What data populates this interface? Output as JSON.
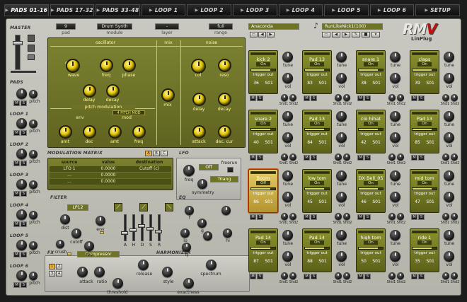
{
  "tabs": [
    {
      "label": "PADS 01-16",
      "active": true
    },
    {
      "label": "PADS 17-32"
    },
    {
      "label": "PADS 33-48"
    },
    {
      "label": "LOOP 1"
    },
    {
      "label": "LOOP 2"
    },
    {
      "label": "LOOP 3"
    },
    {
      "label": "LOOP 4"
    },
    {
      "label": "LOOP 5"
    },
    {
      "label": "LOOP 6"
    },
    {
      "label": "SETUP"
    }
  ],
  "left": {
    "master": "MASTER",
    "pads": "PADS",
    "loops": [
      "LOOP 1",
      "LOOP 2",
      "LOOP 3",
      "LOOP 4",
      "LOOP 5",
      "LOOP 6"
    ],
    "pitch": "pitch",
    "m": "M",
    "s": "S"
  },
  "top": {
    "pad_num": "9",
    "pad_num_lbl": "pad",
    "module": "Drum Synth",
    "module_lbl": "module",
    "layer": "-",
    "layer_lbl": "layer",
    "range": "full",
    "range_lbl": "range"
  },
  "oscillator": {
    "title": "oscillator",
    "knobs": [
      "wave",
      "freq",
      "phase",
      "delay",
      "decay"
    ],
    "pitch_title": "pitch modulation",
    "env": "env",
    "mod": "mod",
    "pm_knobs": [
      "amt",
      "dec",
      "amt",
      "freq"
    ],
    "pm_tag": "4 PITCH MOD"
  },
  "mix": {
    "title": "mix",
    "knob": "mix"
  },
  "noise": {
    "title": "noise",
    "knobs": [
      "col",
      "reso",
      "delay",
      "decay",
      "attack",
      "dec. cur"
    ]
  },
  "modmatrix": {
    "title": "MODULATION MATRIX",
    "tabs": [
      "A",
      "B",
      "C"
    ],
    "headers": [
      "source",
      "value",
      "destination"
    ],
    "rows": [
      [
        "LFO 1",
        "0.0000",
        "Cutoff (c)"
      ],
      [
        "...",
        "0.0000",
        ""
      ],
      [
        "...",
        "0.0000",
        ""
      ]
    ]
  },
  "lfo": {
    "title": "LFO",
    "freq": "freq",
    "off": "Off",
    "freerun": "freerun",
    "wave": "Triang",
    "symmetry": "symmetry"
  },
  "filter": {
    "title": "FILTER",
    "type": "LP12",
    "knobs": [
      "dist",
      "cutoff",
      "env",
      "res",
      "crush"
    ],
    "sliders": [
      "A",
      "H",
      "D",
      "S",
      "R"
    ]
  },
  "eq": {
    "title": "EQ",
    "knobs": [
      "f",
      "g",
      "lo",
      "hi",
      "q"
    ]
  },
  "fx": {
    "title": "FX",
    "effect": "Compressor",
    "knobs": [
      "attack",
      "ratio",
      "threshold",
      "release"
    ],
    "vals": [
      "1",
      "2",
      "3",
      "4"
    ]
  },
  "harmonizer": {
    "title": "HARMONIZER",
    "knobs": [
      "style",
      "exactness",
      "spectrum"
    ]
  },
  "browser": {
    "preset": "Anaconda",
    "kit": "RunLikeNick1(100)",
    "logo": "RM",
    "logo2": "V",
    "brand": "LinPlug"
  },
  "pad_labels": {
    "on": "On",
    "trigger": "trigger",
    "out": "out",
    "tune": "tune",
    "vol": "vol",
    "shd1": "Shd1",
    "shd2": "Shd2",
    "m": "M",
    "s": "S"
  },
  "pads": [
    {
      "name": "kick 2",
      "on": "On",
      "note": "36",
      "out": "S01",
      "bar": 0.8
    },
    {
      "name": "Pad 13",
      "on": "On",
      "note": "83",
      "out": "S01",
      "bar": 0.8
    },
    {
      "name": "snare 1",
      "on": "On",
      "note": "38",
      "out": "S01",
      "bar": 0.8
    },
    {
      "name": "claps",
      "on": "On",
      "note": "39",
      "out": "S01",
      "bar": 0.8
    },
    {
      "name": "snare 2",
      "on": "On",
      "note": "40",
      "out": "S01",
      "bar": 0.8
    },
    {
      "name": "Pad 13",
      "on": "On",
      "note": "84",
      "out": "S01",
      "bar": 0.8
    },
    {
      "name": "clo hihat",
      "on": "On",
      "note": "42",
      "out": "S01",
      "bar": 0.8
    },
    {
      "name": "Pad 13",
      "on": "On",
      "note": "85",
      "out": "S01",
      "bar": 0.8
    },
    {
      "name": "Boom",
      "on": "Off",
      "note": "86",
      "out": "S01",
      "bar": 0.8,
      "selected": true
    },
    {
      "name": "low tom",
      "on": "On",
      "note": "45",
      "out": "S01",
      "bar": 0.8
    },
    {
      "name": "DX Bell_05",
      "on": "On",
      "note": "46",
      "out": "S01",
      "bar": 0.8
    },
    {
      "name": "mid tom",
      "on": "On",
      "note": "47",
      "out": "S01",
      "bar": 0.8
    },
    {
      "name": "Pad 14",
      "on": "On",
      "note": "87",
      "out": "S01",
      "bar": 0.8
    },
    {
      "name": "Pad 14",
      "on": "On",
      "note": "88",
      "out": "S01",
      "bar": 0.8
    },
    {
      "name": "high tom",
      "on": "On",
      "note": "50",
      "out": "S01",
      "bar": 0.8
    },
    {
      "name": "ride 1",
      "on": "On",
      "note": "35",
      "out": "S01",
      "bar": 0.8
    }
  ]
}
